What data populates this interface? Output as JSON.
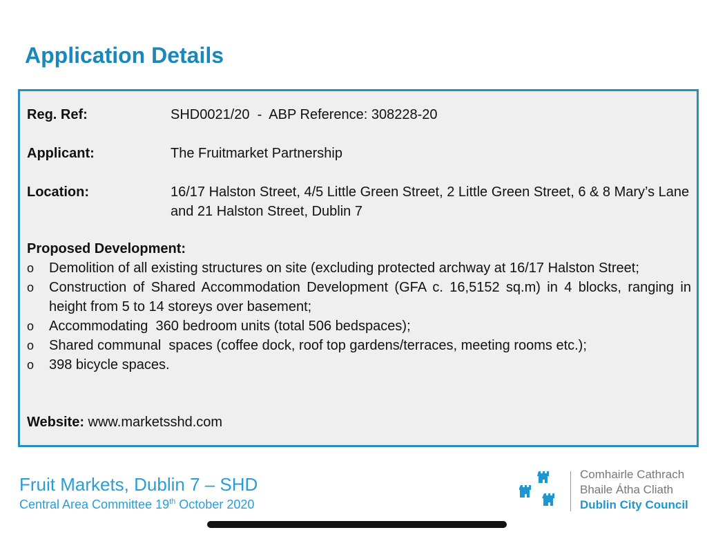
{
  "page": {
    "title": "Application Details"
  },
  "details": {
    "reg_ref": {
      "label": "Reg. Ref:",
      "value": "SHD0021/20  -  ABP Reference: 308228-20"
    },
    "applicant": {
      "label": "Applicant:",
      "value": "The Fruitmarket Partnership"
    },
    "location": {
      "label": "Location:",
      "value": "16/17 Halston Street, 4/5 Little Green Street, 2 Little Green Street, 6 & 8 Mary’s Lane and 21 Halston Street, Dublin 7"
    },
    "proposed_heading": "Proposed Development:",
    "bullet_marker": "o",
    "bullets": [
      "Demolition of all existing structures on site (excluding protected archway at 16/17 Halston Street;",
      "Construction of Shared Accommodation Development (GFA c. 16,5152 sq.m) in 4 blocks, ranging in height from 5 to 14 storeys over basement;",
      "Accommodating  360 bedroom units (total 506 bedspaces);",
      "Shared communal  spaces (coffee dock, roof top gardens/terraces, meeting rooms etc.);",
      "398 bicycle spaces."
    ],
    "website": {
      "label": "Website:",
      "value": "www.marketsshd.com"
    }
  },
  "footer": {
    "title": "Fruit Markets, Dublin 7 – SHD",
    "subtitle_pre": "Central Area Committee 19",
    "subtitle_sup": "th",
    "subtitle_post": " October 2020"
  },
  "logo": {
    "line1": "Comhairle Cathrach",
    "line2": "Bhaile Átha Cliath",
    "line3": "Dublin City Council",
    "icon": "three-castles-icon"
  },
  "colors": {
    "title": "#1b86b8",
    "box_border": "#2a8dbf",
    "box_background": "#efefef",
    "footer_text": "#2a9dd6",
    "logo_blue": "#1e97d0",
    "logo_grey": "#777777"
  }
}
